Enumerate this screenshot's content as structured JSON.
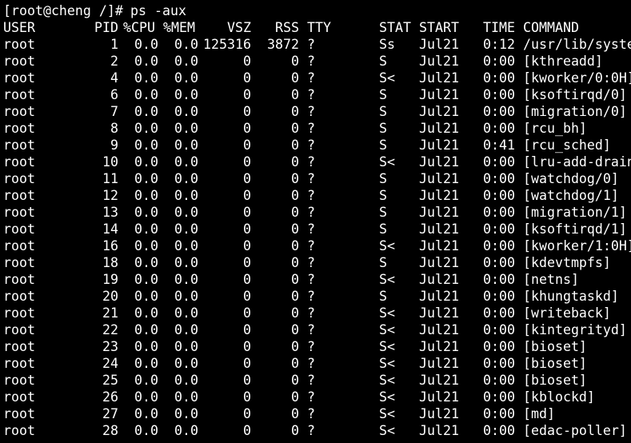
{
  "terminal": {
    "prompt": "[root@cheng /]# ",
    "command": "ps -aux",
    "colors": {
      "background": "#000000",
      "foreground": "#ffffff"
    }
  },
  "header": {
    "user": "USER",
    "pid": "PID",
    "cpu": "%CPU",
    "mem": "%MEM",
    "vsz": "VSZ",
    "rss": "RSS",
    "tty": "TTY",
    "stat": "STAT",
    "start": "START",
    "time": "TIME",
    "command": "COMMAND"
  },
  "rows": [
    {
      "user": "root",
      "pid": "1",
      "cpu": "0.0",
      "mem": "0.0",
      "vsz": "125316",
      "rss": "3872",
      "tty": "?",
      "stat": "Ss",
      "start": "Jul21",
      "time": "0:12",
      "command": "/usr/lib/syste"
    },
    {
      "user": "root",
      "pid": "2",
      "cpu": "0.0",
      "mem": "0.0",
      "vsz": "0",
      "rss": "0",
      "tty": "?",
      "stat": "S",
      "start": "Jul21",
      "time": "0:00",
      "command": "[kthreadd]"
    },
    {
      "user": "root",
      "pid": "4",
      "cpu": "0.0",
      "mem": "0.0",
      "vsz": "0",
      "rss": "0",
      "tty": "?",
      "stat": "S<",
      "start": "Jul21",
      "time": "0:00",
      "command": "[kworker/0:0H]"
    },
    {
      "user": "root",
      "pid": "6",
      "cpu": "0.0",
      "mem": "0.0",
      "vsz": "0",
      "rss": "0",
      "tty": "?",
      "stat": "S",
      "start": "Jul21",
      "time": "0:00",
      "command": "[ksoftirqd/0]"
    },
    {
      "user": "root",
      "pid": "7",
      "cpu": "0.0",
      "mem": "0.0",
      "vsz": "0",
      "rss": "0",
      "tty": "?",
      "stat": "S",
      "start": "Jul21",
      "time": "0:00",
      "command": "[migration/0]"
    },
    {
      "user": "root",
      "pid": "8",
      "cpu": "0.0",
      "mem": "0.0",
      "vsz": "0",
      "rss": "0",
      "tty": "?",
      "stat": "S",
      "start": "Jul21",
      "time": "0:00",
      "command": "[rcu_bh]"
    },
    {
      "user": "root",
      "pid": "9",
      "cpu": "0.0",
      "mem": "0.0",
      "vsz": "0",
      "rss": "0",
      "tty": "?",
      "stat": "S",
      "start": "Jul21",
      "time": "0:41",
      "command": "[rcu_sched]"
    },
    {
      "user": "root",
      "pid": "10",
      "cpu": "0.0",
      "mem": "0.0",
      "vsz": "0",
      "rss": "0",
      "tty": "?",
      "stat": "S<",
      "start": "Jul21",
      "time": "0:00",
      "command": "[lru-add-drain"
    },
    {
      "user": "root",
      "pid": "11",
      "cpu": "0.0",
      "mem": "0.0",
      "vsz": "0",
      "rss": "0",
      "tty": "?",
      "stat": "S",
      "start": "Jul21",
      "time": "0:00",
      "command": "[watchdog/0]"
    },
    {
      "user": "root",
      "pid": "12",
      "cpu": "0.0",
      "mem": "0.0",
      "vsz": "0",
      "rss": "0",
      "tty": "?",
      "stat": "S",
      "start": "Jul21",
      "time": "0:00",
      "command": "[watchdog/1]"
    },
    {
      "user": "root",
      "pid": "13",
      "cpu": "0.0",
      "mem": "0.0",
      "vsz": "0",
      "rss": "0",
      "tty": "?",
      "stat": "S",
      "start": "Jul21",
      "time": "0:00",
      "command": "[migration/1]"
    },
    {
      "user": "root",
      "pid": "14",
      "cpu": "0.0",
      "mem": "0.0",
      "vsz": "0",
      "rss": "0",
      "tty": "?",
      "stat": "S",
      "start": "Jul21",
      "time": "0:00",
      "command": "[ksoftirqd/1]"
    },
    {
      "user": "root",
      "pid": "16",
      "cpu": "0.0",
      "mem": "0.0",
      "vsz": "0",
      "rss": "0",
      "tty": "?",
      "stat": "S<",
      "start": "Jul21",
      "time": "0:00",
      "command": "[kworker/1:0H]"
    },
    {
      "user": "root",
      "pid": "18",
      "cpu": "0.0",
      "mem": "0.0",
      "vsz": "0",
      "rss": "0",
      "tty": "?",
      "stat": "S",
      "start": "Jul21",
      "time": "0:00",
      "command": "[kdevtmpfs]"
    },
    {
      "user": "root",
      "pid": "19",
      "cpu": "0.0",
      "mem": "0.0",
      "vsz": "0",
      "rss": "0",
      "tty": "?",
      "stat": "S<",
      "start": "Jul21",
      "time": "0:00",
      "command": "[netns]"
    },
    {
      "user": "root",
      "pid": "20",
      "cpu": "0.0",
      "mem": "0.0",
      "vsz": "0",
      "rss": "0",
      "tty": "?",
      "stat": "S",
      "start": "Jul21",
      "time": "0:00",
      "command": "[khungtaskd]"
    },
    {
      "user": "root",
      "pid": "21",
      "cpu": "0.0",
      "mem": "0.0",
      "vsz": "0",
      "rss": "0",
      "tty": "?",
      "stat": "S<",
      "start": "Jul21",
      "time": "0:00",
      "command": "[writeback]"
    },
    {
      "user": "root",
      "pid": "22",
      "cpu": "0.0",
      "mem": "0.0",
      "vsz": "0",
      "rss": "0",
      "tty": "?",
      "stat": "S<",
      "start": "Jul21",
      "time": "0:00",
      "command": "[kintegrityd]"
    },
    {
      "user": "root",
      "pid": "23",
      "cpu": "0.0",
      "mem": "0.0",
      "vsz": "0",
      "rss": "0",
      "tty": "?",
      "stat": "S<",
      "start": "Jul21",
      "time": "0:00",
      "command": "[bioset]"
    },
    {
      "user": "root",
      "pid": "24",
      "cpu": "0.0",
      "mem": "0.0",
      "vsz": "0",
      "rss": "0",
      "tty": "?",
      "stat": "S<",
      "start": "Jul21",
      "time": "0:00",
      "command": "[bioset]"
    },
    {
      "user": "root",
      "pid": "25",
      "cpu": "0.0",
      "mem": "0.0",
      "vsz": "0",
      "rss": "0",
      "tty": "?",
      "stat": "S<",
      "start": "Jul21",
      "time": "0:00",
      "command": "[bioset]"
    },
    {
      "user": "root",
      "pid": "26",
      "cpu": "0.0",
      "mem": "0.0",
      "vsz": "0",
      "rss": "0",
      "tty": "?",
      "stat": "S<",
      "start": "Jul21",
      "time": "0:00",
      "command": "[kblockd]"
    },
    {
      "user": "root",
      "pid": "27",
      "cpu": "0.0",
      "mem": "0.0",
      "vsz": "0",
      "rss": "0",
      "tty": "?",
      "stat": "S<",
      "start": "Jul21",
      "time": "0:00",
      "command": "[md]"
    },
    {
      "user": "root",
      "pid": "28",
      "cpu": "0.0",
      "mem": "0.0",
      "vsz": "0",
      "rss": "0",
      "tty": "?",
      "stat": "S<",
      "start": "Jul21",
      "time": "0:00",
      "command": "[edac-poller]"
    }
  ]
}
